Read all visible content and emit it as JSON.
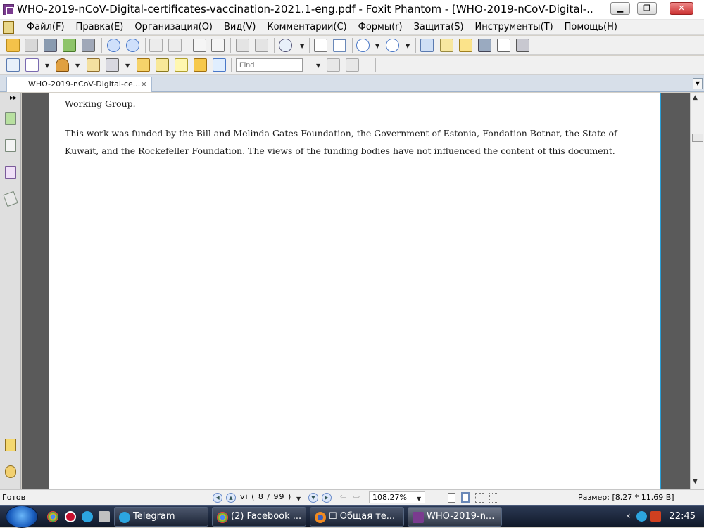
{
  "window": {
    "title": "WHO-2019-nCoV-Digital-certificates-vaccination-2021.1-eng.pdf - Foxit Phantom - [WHO-2019-nCoV-Digital-...",
    "minimize": "▁",
    "maximize": "❐",
    "close": "✕"
  },
  "menu": {
    "items": [
      "Файл(F)",
      "Правка(E)",
      "Организация(O)",
      "Вид(V)",
      "Комментарии(C)",
      "Формы(r)",
      "Защита(S)",
      "Инструменты(T)",
      "Помощь(H)"
    ]
  },
  "toolbar2": {
    "find_placeholder": "Find"
  },
  "tabs": {
    "active_label": "WHO-2019-nCoV-Digital-ce...",
    "close": "×"
  },
  "document": {
    "line1": "Working Group.",
    "para_line1": "This work was funded by the Bill and Melinda Gates Foundation, the Government of Estonia, Fondation Botnar, the State of",
    "para_line2": "Kuwait, and the Rockefeller Foundation. The views of the funding bodies have not influenced the content of this document."
  },
  "status": {
    "ready": "Готов",
    "page_indicator": "vi  ( 8 / 99 )",
    "zoom": "108.27%",
    "size": "Размер: [8.27 * 11.69 В]"
  },
  "taskbar": {
    "items": [
      "Telegram",
      "(2) Facebook ...",
      "☐ Общая те...",
      "WHO-2019-n..."
    ],
    "clock": "22:45",
    "tray_chevron": "‹"
  },
  "colors": {
    "page_border": "#2aa0d8",
    "taskbar": "#1a2438",
    "app_icon": "#7a3b8f"
  }
}
